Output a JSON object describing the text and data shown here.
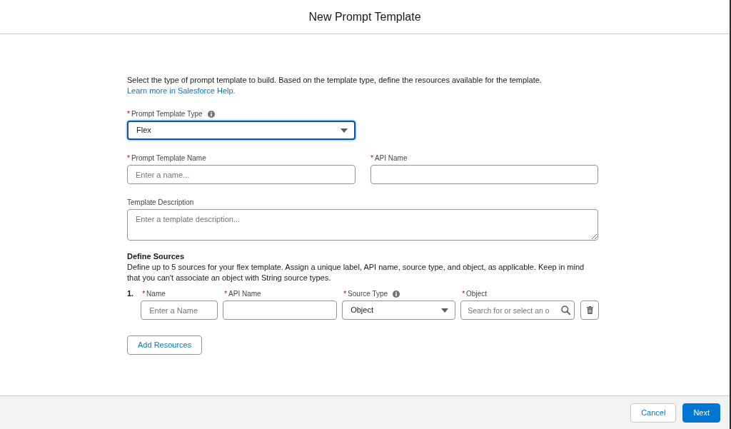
{
  "header": {
    "title": "New Prompt Template"
  },
  "intro": {
    "text": "Select the type of prompt template to build. Based on the template type, define the resources available for the template.",
    "link": "Learn more in Salesforce Help."
  },
  "fields": [
    {
      "kind": "select",
      "label": "Prompt Template Type",
      "required_mark": "*",
      "info": true,
      "value": "Flex",
      "focused": true
    },
    {
      "kind": "input",
      "label": "Prompt Template Name",
      "required_mark": "*",
      "placeholder": "Enter a name...",
      "focused": false
    },
    {
      "kind": "input",
      "label": "API Name",
      "required_mark": "*",
      "focused": false
    },
    {
      "kind": "textarea",
      "label": "Template Description",
      "placeholder": "Enter a template description...",
      "focused": false
    }
  ],
  "sources": {
    "heading": "Define Sources",
    "description": "Define up to 5 sources for your flex template. Assign a unique label, API name, source type, and object, as applicable. Keep in mind that you can't associate an object with String source types.",
    "rows": [
      {
        "number": "1.",
        "fields": [
          {
            "kind": "input",
            "label": "Name",
            "required_mark": "*",
            "placeholder": "Enter a Name"
          },
          {
            "kind": "input",
            "label": "API Name",
            "required_mark": "*"
          },
          {
            "kind": "select",
            "label": "Source Type",
            "required_mark": "*",
            "info": true,
            "value": "Object"
          },
          {
            "kind": "search",
            "label": "Object",
            "required_mark": "*",
            "placeholder": "Search for or select an o"
          }
        ]
      }
    ],
    "add_button": "Add Resources"
  },
  "footer": {
    "buttons": [
      {
        "label": "Cancel",
        "kind": "neutral"
      },
      {
        "label": "Next",
        "kind": "brand"
      }
    ]
  }
}
